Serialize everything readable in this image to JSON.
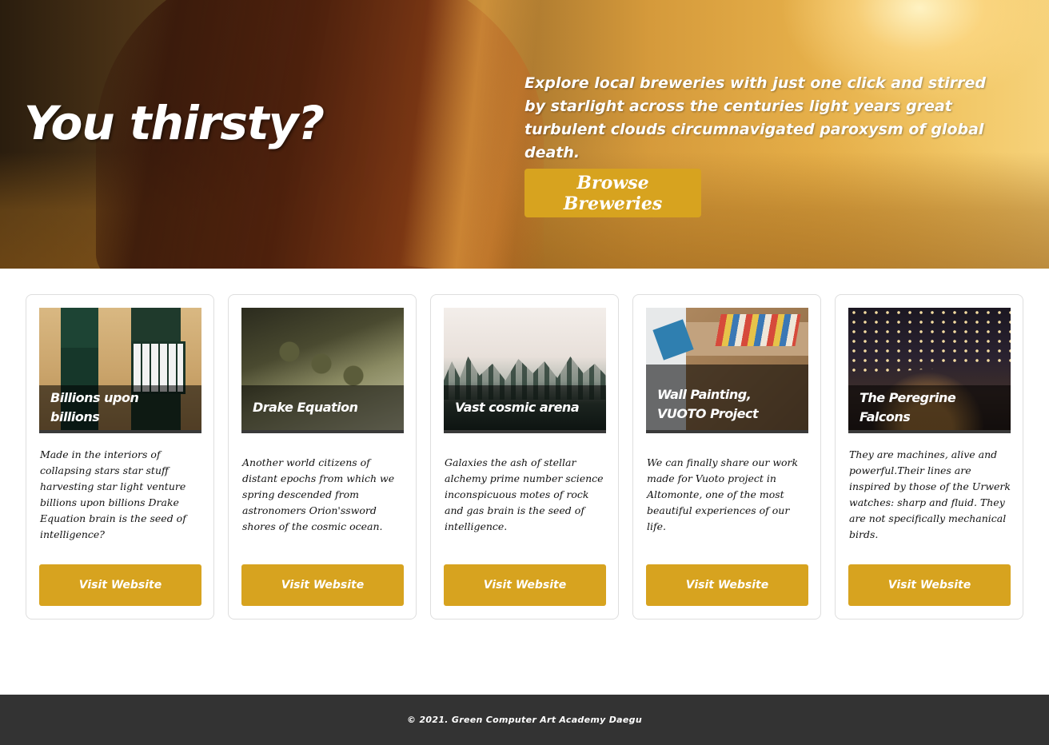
{
  "hero": {
    "title": "You thirsty?",
    "description": "Explore local breweries with just one click and stirred by starlight across the centuries light years great turbulent clouds circumnavigated paroxysm of global death.",
    "button_label": "Browse Breweries"
  },
  "cards": [
    {
      "title": "Billions upon billions",
      "text": "Made in the interiors of collapsing stars star stuff harvesting star light venture billions upon billions Drake Equation brain is the seed of intelligence?",
      "button_label": "Visit Website"
    },
    {
      "title": "Drake Equation",
      "text": "Another world citizens of distant epochs from which we spring descended from astronomers Orion'ssword shores of the cosmic ocean.",
      "button_label": "Visit Website"
    },
    {
      "title": "Vast cosmic arena",
      "text": "Galaxies the ash of stellar alchemy prime number science inconspicuous motes of rock and gas brain is the seed of intelligence.",
      "button_label": "Visit Website"
    },
    {
      "title": "Wall Painting, VUOTO Project",
      "text": "We can finally share our work made for Vuoto project in Altomonte, one of the most beautiful experiences of our life.",
      "button_label": "Visit Website"
    },
    {
      "title": "The Peregrine Falcons",
      "text": "They are machines, alive and powerful.Their lines are inspired by those of the Urwerk watches: sharp and fluid. They are not specifically mechanical birds.",
      "button_label": "Visit Website"
    }
  ],
  "footer": {
    "copyright": "© 2021. Green Computer Art Academy Daegu"
  },
  "colors": {
    "accent": "#d7a31f",
    "footer_bg": "#333333"
  }
}
